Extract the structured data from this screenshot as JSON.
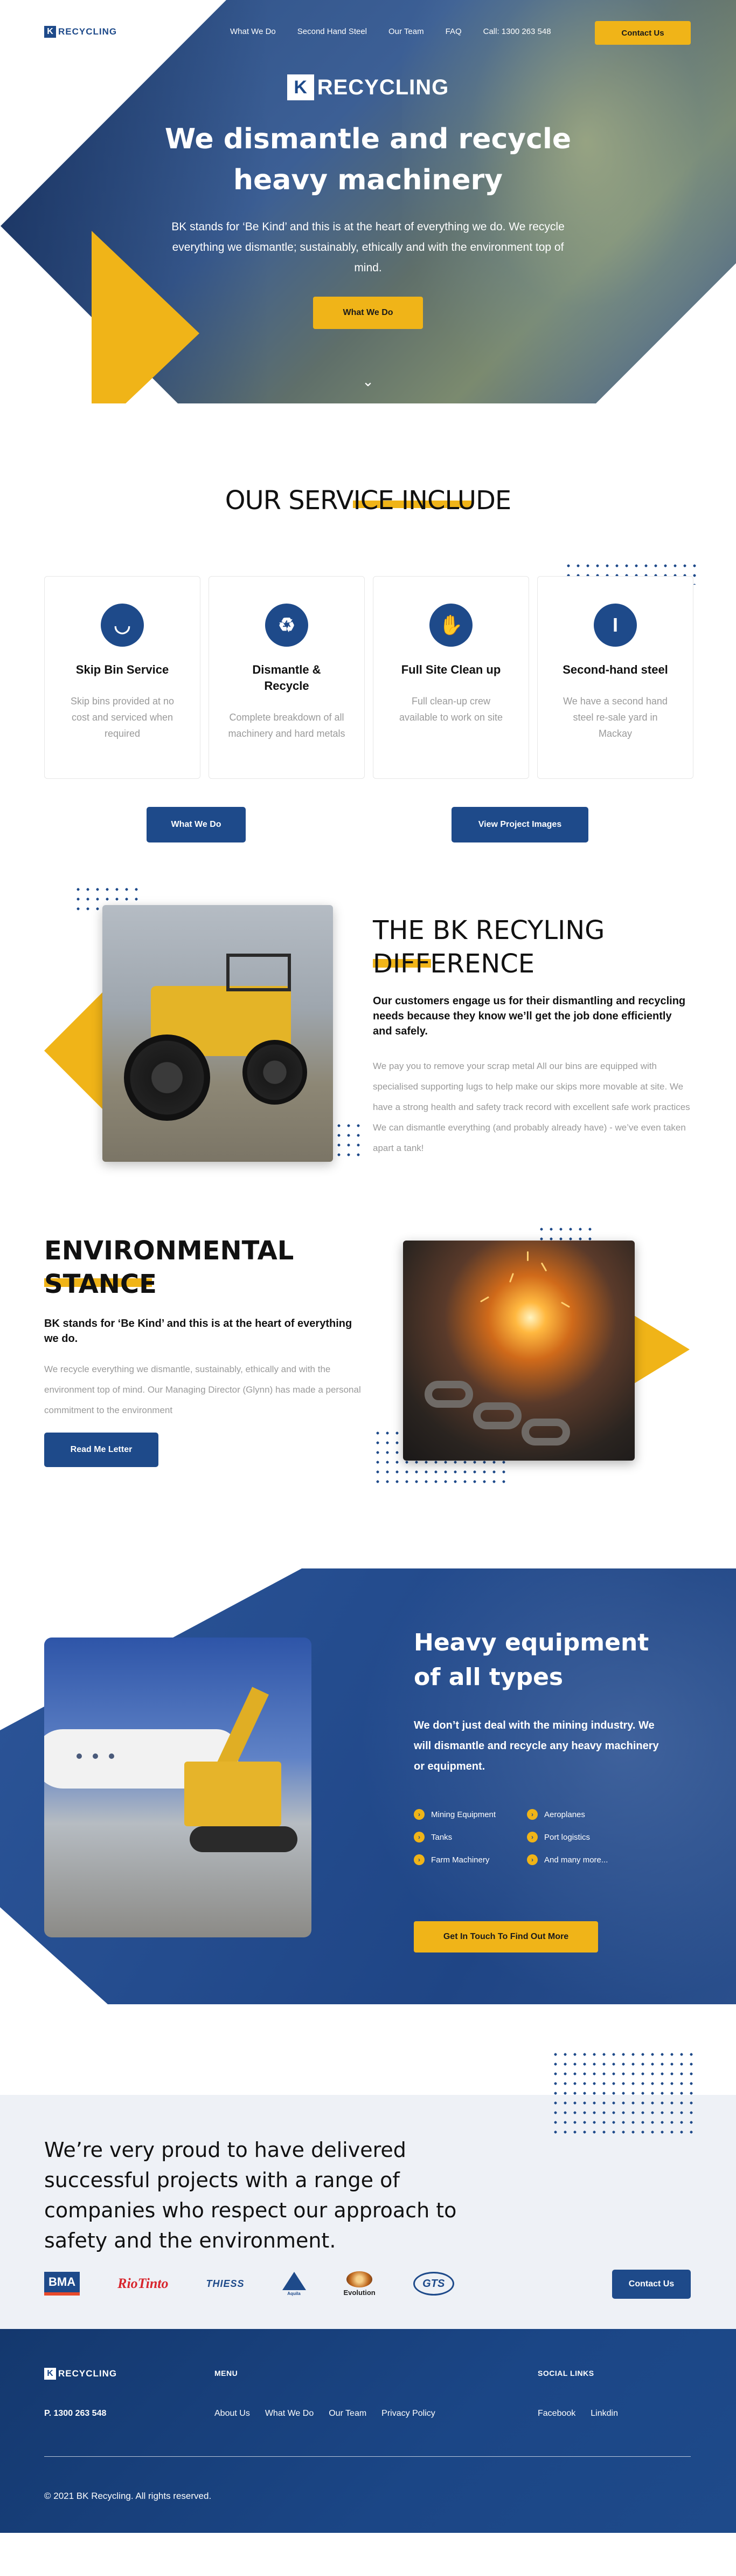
{
  "brand": {
    "mark": "K",
    "name": "RECYCLING"
  },
  "nav": {
    "links": [
      "What We Do",
      "Second Hand Steel",
      "Our Team",
      "FAQ",
      "Call: 1300 263 548"
    ],
    "cta": "Contact Us"
  },
  "hero": {
    "title": "We dismantle and recycle heavy machinery",
    "subtitle": "BK stands for ‘Be Kind’ and this is at the heart of everything we do. We recycle everything we dismantle; sustainably, ethically and with the environment top of mind.",
    "button": "What We Do",
    "scroll_icon": "chevron-down-icon"
  },
  "services": {
    "title": "OUR SERVICE INCLUDE",
    "cards": [
      {
        "icon": "skip-bin-icon",
        "glyph": "◡",
        "title": "Skip Bin Service",
        "text": "Skip bins provided at no cost and serviced when required"
      },
      {
        "icon": "recycle-icon",
        "glyph": "♻",
        "title": "Dismantle & Recycle",
        "text": "Complete breakdown of all machinery and hard metals"
      },
      {
        "icon": "gloves-icon",
        "glyph": "✋",
        "title": "Full Site Clean up",
        "text": "Full clean-up crew available to work on site"
      },
      {
        "icon": "steel-beam-icon",
        "glyph": "I",
        "title": "Second-hand steel",
        "text": "We have a second hand steel re-sale yard in Mackay"
      }
    ],
    "button_left": "What We Do",
    "button_right": "View Project Images"
  },
  "difference": {
    "title_line1": "THE BK RECYLING",
    "title_line2": "DIFFERENCE",
    "lead": "Our customers engage us for their dismantling and recycling needs because they know we’ll get the job done efficiently and safely.",
    "body": "We pay you to remove your scrap metal All our bins are equipped with specialised supporting lugs to help make our skips more movable at site. We have a strong health and safety track record with excellent safe work practices We can dismantle everything (and probably already have) - we’ve even taken apart a tank!"
  },
  "environment": {
    "title_line1": "ENVIRONMENTAL",
    "title_line2": "STANCE",
    "lead": "BK stands for ‘Be Kind’ and this is at the heart of everything we do.",
    "body": "We recycle everything we dismantle, sustainably, ethically and with the environment top of mind. Our Managing Director (Glynn) has made a personal commitment to the environment",
    "button": "Read Me Letter"
  },
  "heavy": {
    "title": "Heavy equipment of all types",
    "lead": "We don’t just deal with the mining industry. We will dismantle and recycle any heavy machinery or equipment.",
    "types": [
      "Mining Equipment",
      "Aeroplanes",
      "Tanks",
      "Port logistics",
      "Farm Machinery",
      "And many more..."
    ],
    "button": "Get In Touch To Find Out More"
  },
  "clients": {
    "text": "We’re very proud to have delivered successful projects with a range of companies who respect our approach to safety and the environment.",
    "logos": [
      "BMA",
      "RioTinto",
      "THIESS",
      "Aquila",
      "Evolution",
      "GTS"
    ],
    "button": "Contact Us"
  },
  "footer": {
    "phone": "P. 1300 263 548",
    "menu_heading": "MENU",
    "menu": [
      "About Us",
      "What We Do",
      "Our Team",
      "Privacy Policy"
    ],
    "social_heading": "SOCIAL LINKS",
    "social": [
      "Facebook",
      "Linkdin"
    ],
    "copyright": "© 2021 BK Recycling. All rights reserved."
  },
  "colors": {
    "brand_blue": "#1e4a8a",
    "accent_yellow": "#f0b418",
    "muted_text": "#9a9a9a"
  }
}
